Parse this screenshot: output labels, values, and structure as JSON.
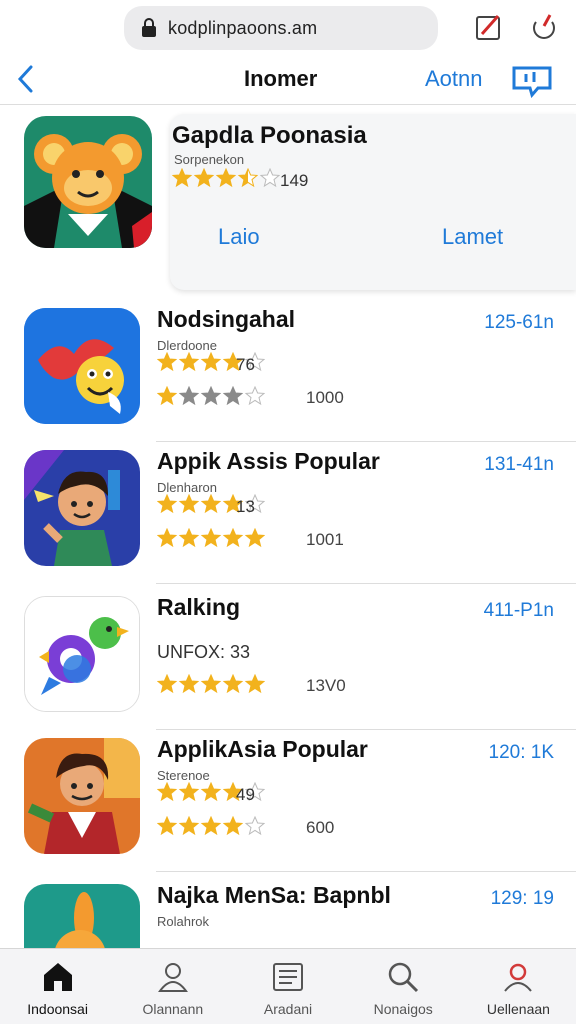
{
  "browser": {
    "url": "kodplinpaoons.am"
  },
  "nav": {
    "title": "Inomer",
    "action": "Aotnn"
  },
  "featured": {
    "name": "Gapdla Poonasia",
    "subtitle": "Sorpenekon",
    "rating": 3.5,
    "rating_count": "149",
    "button_left": "Laio",
    "button_right": "Lamet",
    "icon": "monkey-mascot-icon"
  },
  "apps": [
    {
      "name": "Nodsingahal",
      "subtitle": "Dlerdoone",
      "rating": 4,
      "rating_count": "76",
      "rating2": 4,
      "count2": "1000",
      "size": "125-61n",
      "icon": "bird-emoji-icon"
    },
    {
      "name": "Appik Assis Popular",
      "subtitle": "Dlenharon",
      "rating": 4,
      "rating_count": "13",
      "rating2": 5,
      "count2": "1001",
      "size": "131-41n",
      "icon": "hero-character-icon"
    },
    {
      "name": "Ralking",
      "subtitle": "UNFOX: 33",
      "rating": 0,
      "rating_count": "",
      "rating2": 5,
      "count2": "13V0",
      "size": "411-P1n",
      "icon": "chat-bubble-bird-icon"
    },
    {
      "name": "ApplikAsia Popular",
      "subtitle": "Sterenoe",
      "rating": 4,
      "rating_count": "49",
      "rating2": 4,
      "count2": "600",
      "size": "120: 1K",
      "icon": "warrior-character-icon"
    },
    {
      "name": "Najka MenSa: Bapnbl",
      "subtitle": "Rolahrok",
      "rating": 0,
      "rating_count": "",
      "rating2": 0,
      "count2": "",
      "size": "129: 19",
      "icon": "rabbit-character-icon"
    }
  ],
  "tabs": [
    {
      "label": "Indoonsai",
      "icon": "home-icon"
    },
    {
      "label": "Olannann",
      "icon": "person-icon"
    },
    {
      "label": "Aradani",
      "icon": "list-icon"
    },
    {
      "label": "Nonaigos",
      "icon": "search-icon"
    },
    {
      "label": "Uellenaan",
      "icon": "profile-icon"
    }
  ],
  "colors": {
    "accent": "#1f7ad8",
    "star": "#f2b21d",
    "star_gray": "#8a8a8a"
  }
}
